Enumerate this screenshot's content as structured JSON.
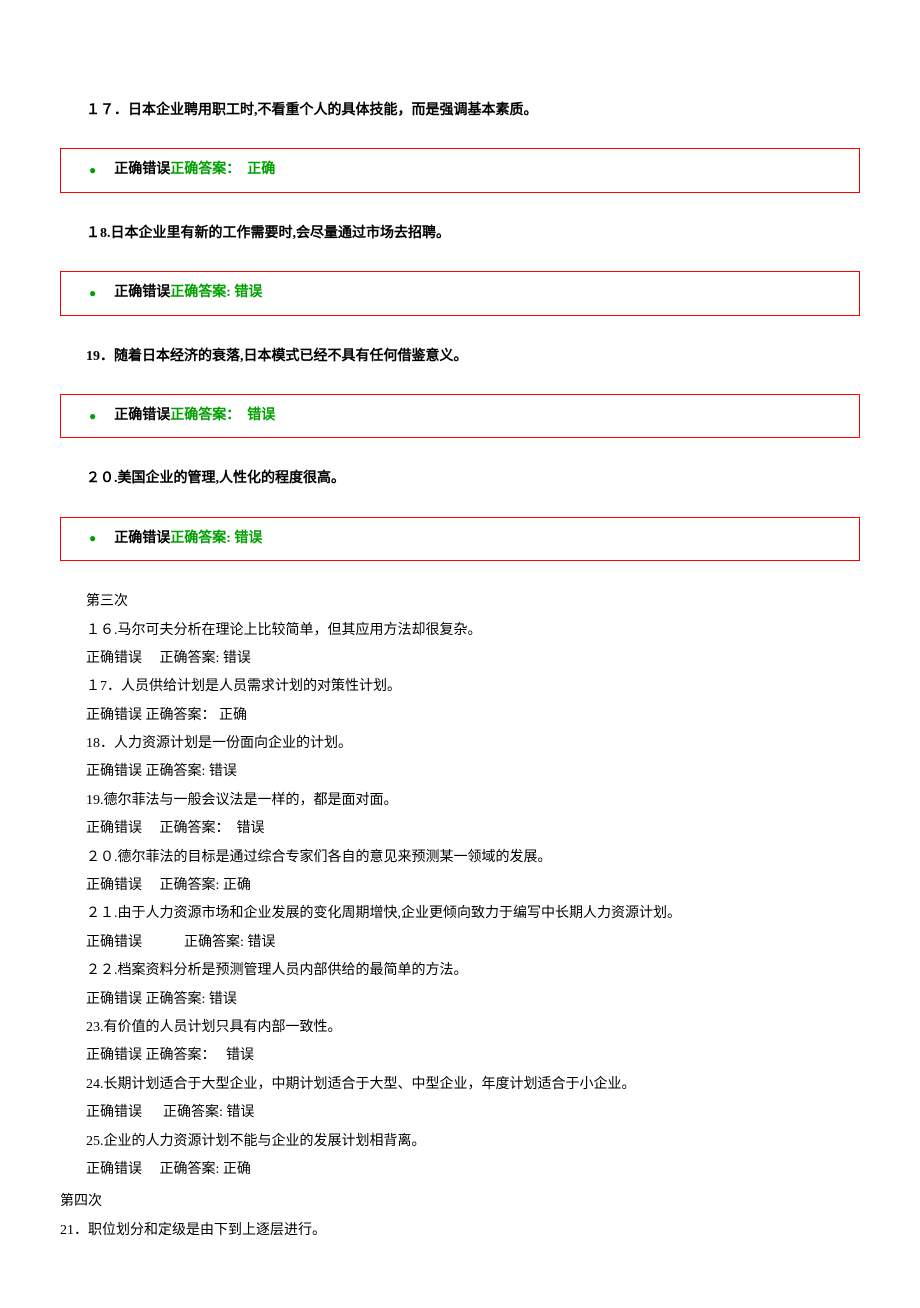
{
  "q17": {
    "text": "１７．日本企业聘用职工时,不看重个人的具体技能，而是强调基本素质。",
    "choices": "正确错误",
    "label": "正确答案：",
    "answer": "正确"
  },
  "q18": {
    "text": "１8.日本企业里有新的工作需要时,会尽量通过市场去招聘。",
    "choices": "正确错误",
    "label": "正确答案:",
    "answer": "错误"
  },
  "q19": {
    "text": "19．随着日本经济的衰落,日本模式已经不具有任何借鉴意义。",
    "choices": "正确错误",
    "label": "正确答案：",
    "answer": "错误"
  },
  "q20": {
    "text": "２０.美国企业的管理,人性化的程度很高。",
    "choices": "正确错误",
    "label": "正确答案:",
    "answer": "错误"
  },
  "section3": {
    "heading": "第三次",
    "lines": [
      "１６.马尔可夫分析在理论上比较简单，但其应用方法却很复杂。",
      "正确错误　 正确答案:  错误",
      "１7．人员供给计划是人员需求计划的对策性计划。",
      "正确错误  正确答案： 正确",
      "18．人力资源计划是一份面向企业的计划。",
      "正确错误  正确答案:  错误",
      "19.德尔菲法与一般会议法是一样的，都是面对面。",
      "正确错误　 正确答案：　错误",
      "２０.德尔菲法的目标是通过综合专家们各自的意见来预测某一领域的发展。",
      "正确错误　 正确答案:  正确",
      "２１.由于人力资源市场和企业发展的变化周期增快,企业更倾向致力于编写中长期人力资源计划。",
      "正确错误　　　正确答案:  错误",
      "２２.档案资料分析是预测管理人员内部供给的最简单的方法。",
      "正确错误  正确答案:  错误",
      "23.有价值的人员计划只具有内部一致性。",
      "正确错误  正确答案：　 错误",
      "24.长期计划适合于大型企业，中期计划适合于大型、中型企业，年度计划适合于小企业。",
      "正确错误 　 正确答案:  错误",
      "25.企业的人力资源计划不能与企业的发展计划相背离。",
      "正确错误　 正确答案:  正确"
    ]
  },
  "section4": {
    "heading": "第四次",
    "line1": "21．职位划分和定级是由下到上逐层进行。"
  }
}
